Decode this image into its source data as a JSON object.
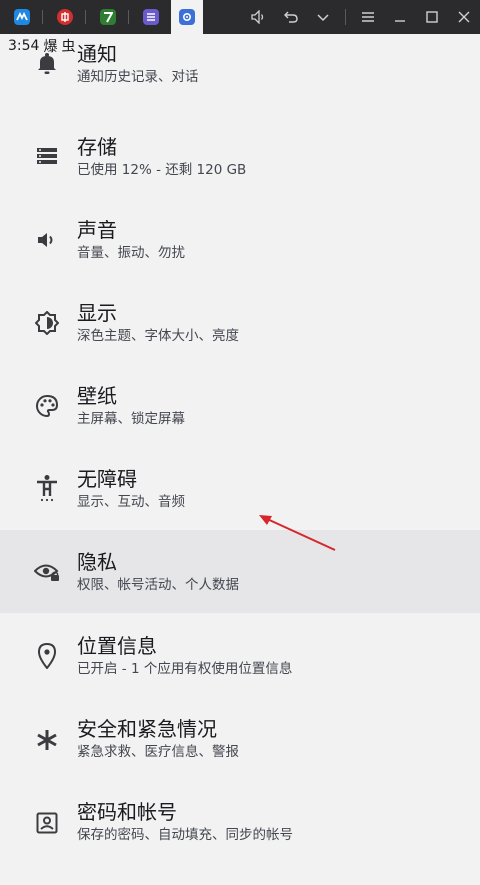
{
  "status": {
    "time": "3:54",
    "glyph1": "爆",
    "glyph2": "虫"
  },
  "settings": [
    {
      "title": "通知",
      "subtitle": "通知历史记录、对话",
      "icon": "bell-icon"
    },
    {
      "title": "存储",
      "subtitle": "已使用 12% - 还剩 120 GB",
      "icon": "storage-icon"
    },
    {
      "title": "声音",
      "subtitle": "音量、振动、勿扰",
      "icon": "volume-icon"
    },
    {
      "title": "显示",
      "subtitle": "深色主题、字体大小、亮度",
      "icon": "brightness-icon"
    },
    {
      "title": "壁纸",
      "subtitle": "主屏幕、锁定屏幕",
      "icon": "palette-icon"
    },
    {
      "title": "无障碍",
      "subtitle": "显示、互动、音频",
      "icon": "accessibility-icon"
    },
    {
      "title": "隐私",
      "subtitle": "权限、帐号活动、个人数据",
      "icon": "privacy-eye-icon"
    },
    {
      "title": "位置信息",
      "subtitle": "已开启 - 1 个应用有权使用位置信息",
      "icon": "location-pin-icon"
    },
    {
      "title": "安全和紧急情况",
      "subtitle": "紧急求救、医疗信息、警报",
      "icon": "asterisk-icon"
    },
    {
      "title": "密码和帐号",
      "subtitle": "保存的密码、自动填充、同步的帐号",
      "icon": "account-box-icon"
    }
  ],
  "tabs": [
    {
      "icon": "app-tab-blue-icon",
      "color": "#1e88e5"
    },
    {
      "icon": "app-tab-red-icon",
      "color": "#d32f2f"
    },
    {
      "icon": "app-tab-green-icon",
      "color": "#2e7d32"
    },
    {
      "icon": "app-tab-purple-icon",
      "color": "#6a5acd"
    },
    {
      "icon": "settings-gear-tab-icon",
      "color": "#3d6fd8"
    }
  ],
  "colors": {
    "highlight": "#e6e6e8",
    "arrow": "#d7262b",
    "background": "#f2f2f3"
  }
}
